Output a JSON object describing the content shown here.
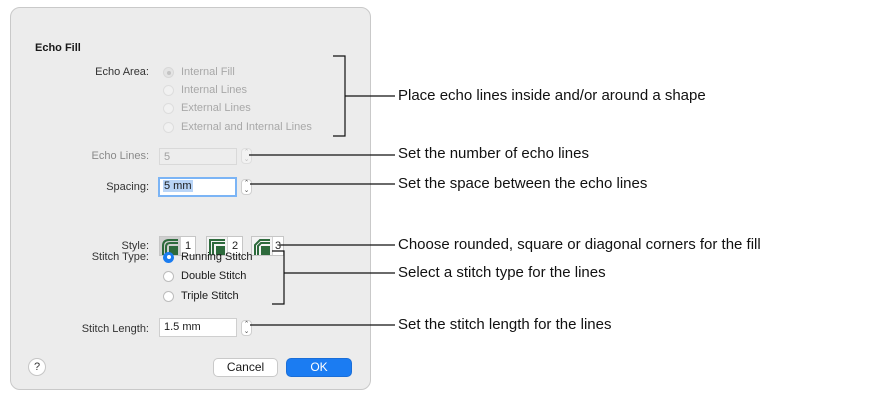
{
  "dialog": {
    "section_title": "Echo Fill",
    "echo_area": {
      "label": "Echo Area:",
      "options": [
        "Internal Fill",
        "Internal Lines",
        "External Lines",
        "External and Internal Lines"
      ],
      "selected": "Internal Fill"
    },
    "echo_lines": {
      "label": "Echo Lines:",
      "value": "5"
    },
    "spacing": {
      "label": "Spacing:",
      "value": "5 mm"
    },
    "style": {
      "label": "Style:",
      "options": [
        "1",
        "2",
        "3"
      ],
      "selected": "1"
    },
    "stitch_type": {
      "label": "Stitch Type:",
      "options": [
        "Running Stitch",
        "Double Stitch",
        "Triple Stitch"
      ],
      "selected": "Running Stitch"
    },
    "stitch_length": {
      "label": "Stitch Length:",
      "value": "1.5 mm"
    },
    "help_label": "?",
    "cancel_label": "Cancel",
    "ok_label": "OK"
  },
  "callouts": {
    "echo_area": "Place echo lines inside and/or around a shape",
    "echo_lines": "Set the number of echo lines",
    "spacing": "Set the space between the echo lines",
    "style": "Choose rounded, square or diagonal corners for the fill",
    "stitch_type": "Select a stitch type for the lines",
    "stitch_length": "Set the stitch length for the lines"
  },
  "colors": {
    "accent": "#1b7cf2",
    "focus_ring": "#7bb4f5"
  },
  "icons": {
    "stepper": "up-down-chevron-icon",
    "style": "corner-style-icon"
  }
}
